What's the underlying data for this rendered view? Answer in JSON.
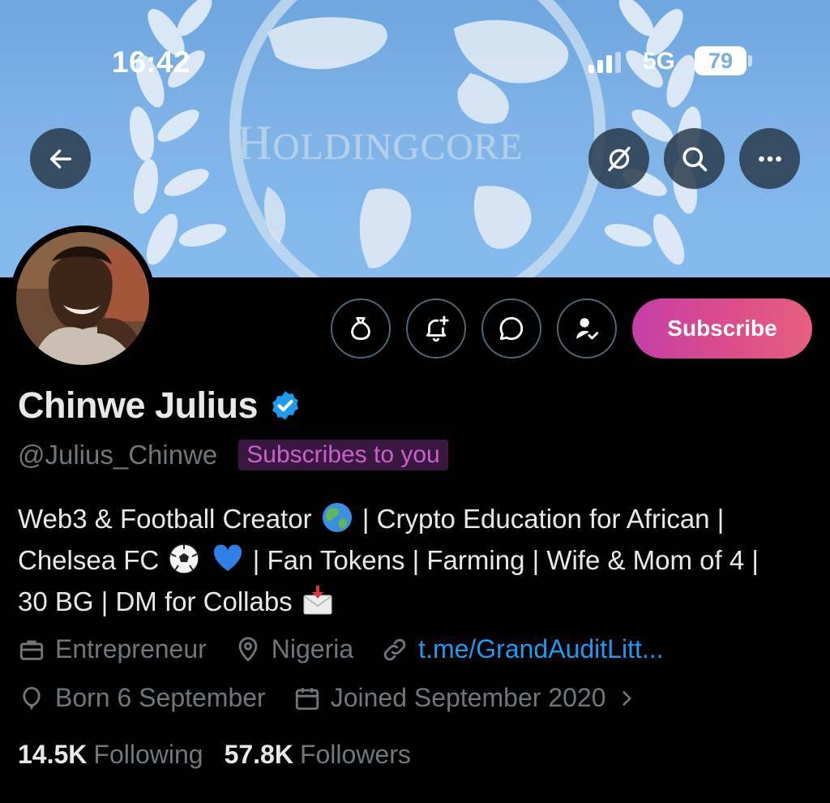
{
  "status_bar": {
    "time": "16:42",
    "network": "5G",
    "battery": "79"
  },
  "banner": {
    "title_big_h": "H",
    "title_rest": "OLDINGCORE"
  },
  "header_buttons": [
    "back",
    "translate",
    "search",
    "more"
  ],
  "profile": {
    "name": "Chinwe Julius",
    "handle": "@Julius_Chinwe",
    "subscribes_badge": "Subscribes to you",
    "subscribe_label": "Subscribe",
    "bio": {
      "line1_a": "Web3 & Football Creator",
      "line1_b": "| Crypto Education for African |",
      "line2_a": "Chelsea FC",
      "line2_b": "| Fan Tokens | Farming | Wife & Mom of 4 |",
      "line3_a": "30 BG | DM for Collabs"
    },
    "meta": {
      "profession": "Entrepreneur",
      "location": "Nigeria",
      "link": "t.me/GrandAuditLitt...",
      "birthday": "Born 6 September",
      "joined": "Joined September 2020"
    },
    "stats": {
      "following_count": "14.5K",
      "following_label": "Following",
      "followers_count": "57.8K",
      "followers_label": "Followers"
    }
  },
  "colors": {
    "background": "#000000",
    "primary_text": "#e7e9ea",
    "secondary_text": "#71767b",
    "link": "#1d9bf0",
    "verified": "#1d9bf0",
    "subscribe_gradient_start": "#c43fa8",
    "subscribe_gradient_end": "#e5607f",
    "badge_bg": "#3a1740",
    "badge_text": "#c862c8"
  }
}
